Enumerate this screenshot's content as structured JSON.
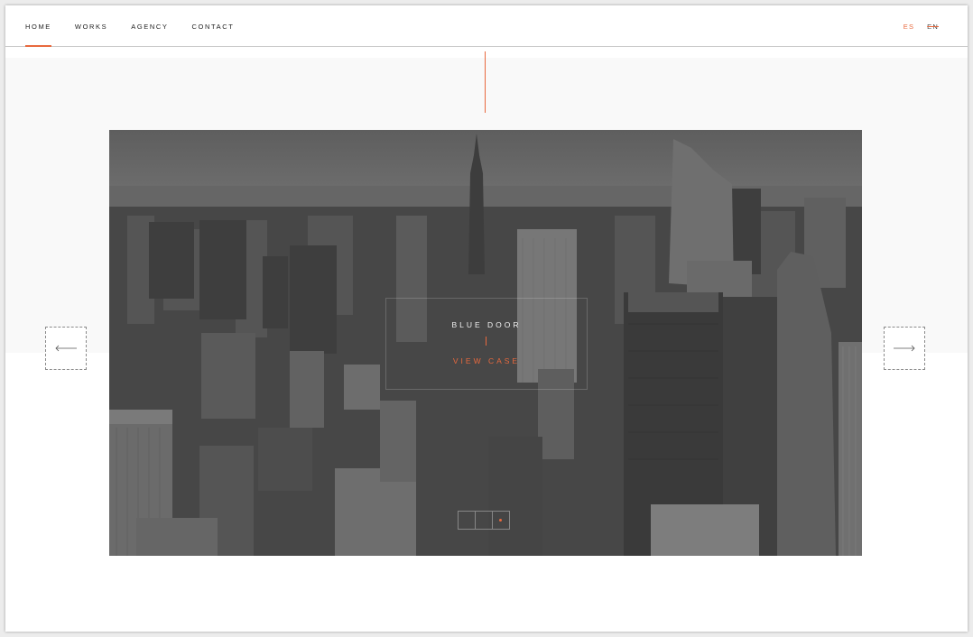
{
  "nav": {
    "items": [
      {
        "label": "HOME",
        "active": true
      },
      {
        "label": "WORKS",
        "active": false
      },
      {
        "label": "AGENCY",
        "active": false
      },
      {
        "label": "CONTACT",
        "active": false
      }
    ]
  },
  "lang": {
    "es": "ES",
    "en": "EN"
  },
  "slide": {
    "title": "BLUE DOOR",
    "link": "VIEW CASE",
    "pagination": {
      "total": 3,
      "active_index": 2
    }
  },
  "colors": {
    "accent": "#e8693e",
    "overlay": "#4a4a4a",
    "text": "#222222"
  },
  "icons": {
    "prev": "arrow-left-icon",
    "next": "arrow-right-icon"
  }
}
